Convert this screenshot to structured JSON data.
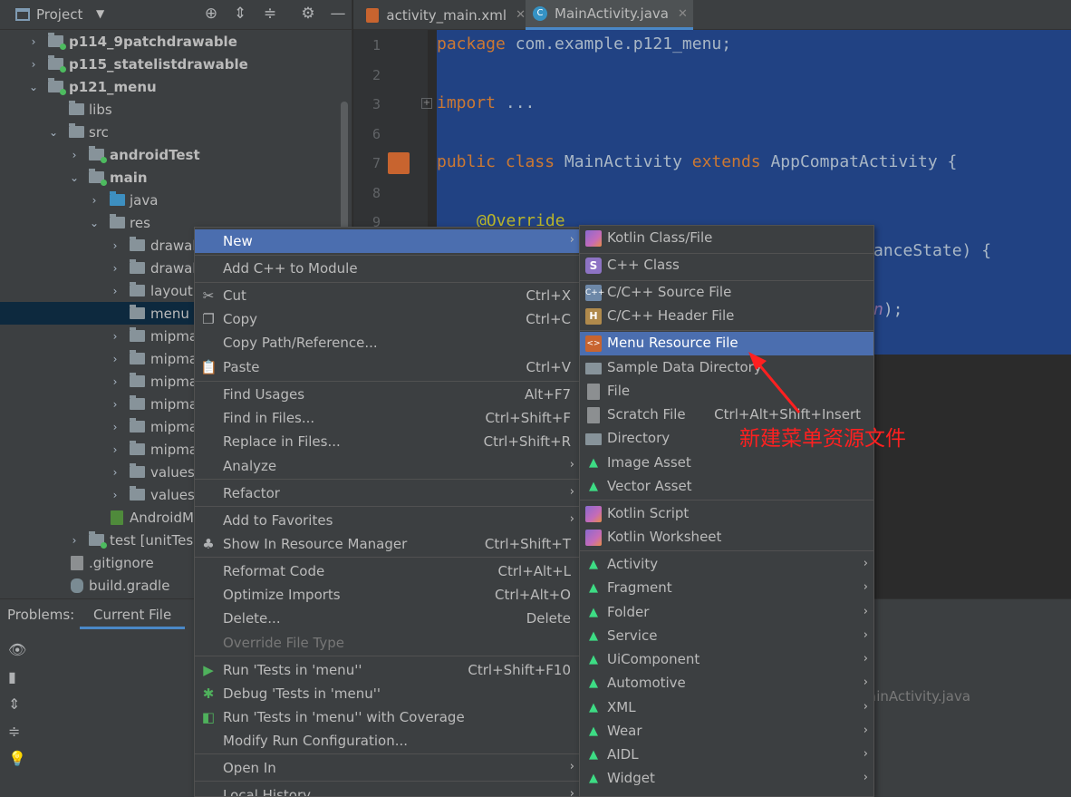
{
  "project_panel": {
    "title": "Project",
    "tree": [
      {
        "label": "p114_9patchdrawable",
        "bold": true
      },
      {
        "label": "p115_statelistdrawable",
        "bold": true
      },
      {
        "label": "p121_menu",
        "bold": true
      },
      {
        "label": "libs"
      },
      {
        "label": "src"
      },
      {
        "label": "androidTest",
        "bold": true
      },
      {
        "label": "main",
        "bold": true
      },
      {
        "label": "java"
      },
      {
        "label": "res"
      },
      {
        "label": "drawab"
      },
      {
        "label": "drawab"
      },
      {
        "label": "layout"
      },
      {
        "label": "menu"
      },
      {
        "label": "mipma"
      },
      {
        "label": "mipma"
      },
      {
        "label": "mipma"
      },
      {
        "label": "mipma"
      },
      {
        "label": "mipma"
      },
      {
        "label": "mipma"
      },
      {
        "label": "values"
      },
      {
        "label": "values-"
      },
      {
        "label": "AndroidM"
      },
      {
        "label": "test [unitTes"
      },
      {
        "label": ".gitignore"
      },
      {
        "label": "build.gradle"
      }
    ]
  },
  "editor": {
    "tabs": [
      {
        "label": "activity_main.xml"
      },
      {
        "label": "MainActivity.java"
      }
    ],
    "line_numbers": [
      "1",
      "2",
      "3",
      "6",
      "7",
      "8",
      "9"
    ],
    "code": {
      "package_kw": "package",
      "package_name": " com.example.p121_menu;",
      "import_kw": "import",
      "import_rest": " ...",
      "public_class": "public class",
      "class_name": " MainActivity ",
      "extends_kw": "extends",
      "super_class": " AppCompatActivity {",
      "override": "@Override",
      "fragment1": "anceState) {",
      "fragment2": "n",
      "fragment3": ");"
    }
  },
  "problems": {
    "label": "Problems:",
    "tab": "Current File",
    "hint": "ainActivity.java"
  },
  "context_menu": {
    "items": [
      {
        "label": "New",
        "submenu": true,
        "highlighted": true
      },
      {
        "label": "Add C++ to Module"
      },
      {
        "label": "Cut",
        "shortcut": "Ctrl+X",
        "icon": "cut-icon"
      },
      {
        "label": "Copy",
        "shortcut": "Ctrl+C",
        "icon": "copy-icon"
      },
      {
        "label": "Copy Path/Reference..."
      },
      {
        "label": "Paste",
        "shortcut": "Ctrl+V",
        "icon": "paste-icon"
      },
      {
        "label": "Find Usages",
        "shortcut": "Alt+F7"
      },
      {
        "label": "Find in Files...",
        "shortcut": "Ctrl+Shift+F"
      },
      {
        "label": "Replace in Files...",
        "shortcut": "Ctrl+Shift+R"
      },
      {
        "label": "Analyze",
        "submenu": true
      },
      {
        "label": "Refactor",
        "submenu": true
      },
      {
        "label": "Add to Favorites",
        "submenu": true
      },
      {
        "label": "Show In Resource Manager",
        "shortcut": "Ctrl+Shift+T",
        "icon": "resource-manager-icon"
      },
      {
        "label": "Reformat Code",
        "shortcut": "Ctrl+Alt+L"
      },
      {
        "label": "Optimize Imports",
        "shortcut": "Ctrl+Alt+O"
      },
      {
        "label": "Delete...",
        "shortcut": "Delete"
      },
      {
        "label": "Override File Type",
        "disabled": true
      },
      {
        "label": "Run 'Tests in 'menu''",
        "shortcut": "Ctrl+Shift+F10",
        "icon": "run-icon"
      },
      {
        "label": "Debug 'Tests in 'menu''",
        "icon": "debug-icon"
      },
      {
        "label": "Run 'Tests in 'menu'' with Coverage",
        "icon": "coverage-icon"
      },
      {
        "label": "Modify Run Configuration..."
      },
      {
        "label": "Open In",
        "submenu": true
      },
      {
        "label": "Local History",
        "submenu": true
      }
    ]
  },
  "new_submenu": {
    "items": [
      {
        "label": "Kotlin Class/File",
        "icon": "kotlin-icon"
      },
      {
        "label": "C++ Class",
        "icon": "cpp-class-icon",
        "glyph": "S"
      },
      {
        "label": "C/C++ Source File",
        "icon": "cpp-source-icon",
        "glyph": "C++"
      },
      {
        "label": "C/C++ Header File",
        "icon": "cpp-header-icon",
        "glyph": "H"
      },
      {
        "label": "Menu Resource File",
        "icon": "menu-resource-icon",
        "glyph": "<>",
        "highlighted": true
      },
      {
        "label": "Sample Data Directory",
        "icon": "folder-icon"
      },
      {
        "label": "File",
        "icon": "file-icon"
      },
      {
        "label": "Scratch File",
        "shortcut": "Ctrl+Alt+Shift+Insert",
        "icon": "scratch-file-icon"
      },
      {
        "label": "Directory",
        "icon": "folder-icon"
      },
      {
        "label": "Image Asset",
        "icon": "android-icon"
      },
      {
        "label": "Vector Asset",
        "icon": "android-icon"
      },
      {
        "label": "Kotlin Script",
        "icon": "kotlin-icon"
      },
      {
        "label": "Kotlin Worksheet",
        "icon": "kotlin-icon"
      },
      {
        "label": "Activity",
        "icon": "android-icon",
        "submenu": true
      },
      {
        "label": "Fragment",
        "icon": "android-icon",
        "submenu": true
      },
      {
        "label": "Folder",
        "icon": "android-icon",
        "submenu": true
      },
      {
        "label": "Service",
        "icon": "android-icon",
        "submenu": true
      },
      {
        "label": "UiComponent",
        "icon": "android-icon",
        "submenu": true
      },
      {
        "label": "Automotive",
        "icon": "android-icon",
        "submenu": true
      },
      {
        "label": "XML",
        "icon": "android-icon",
        "submenu": true
      },
      {
        "label": "Wear",
        "icon": "android-icon",
        "submenu": true
      },
      {
        "label": "AIDL",
        "icon": "android-icon",
        "submenu": true
      },
      {
        "label": "Widget",
        "icon": "android-icon",
        "submenu": true
      }
    ]
  },
  "annotation": {
    "text": "新建菜单资源文件",
    "color": "#ff2020"
  },
  "colors": {
    "highlight": "#4b6eaf",
    "selection_bg": "#214283",
    "android_green": "#3ddc84"
  },
  "glyphs": {
    "arrow_right": "›",
    "arrow_down": "⌄",
    "dropdown": "▼"
  }
}
